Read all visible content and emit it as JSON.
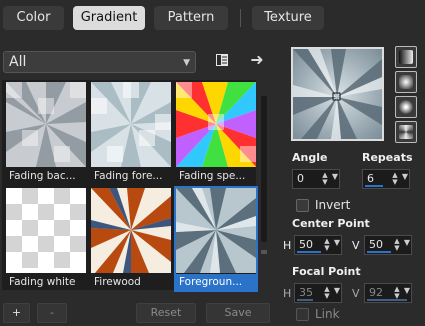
{
  "tabs": [
    "Color",
    "Gradient",
    "Pattern",
    "Texture"
  ],
  "active_tab": "Gradient",
  "category_select": {
    "value": "All"
  },
  "thumbnails": [
    {
      "label": "Fading bac...",
      "selected": false
    },
    {
      "label": "Fading fore...",
      "selected": false
    },
    {
      "label": "Fading spe...",
      "selected": false
    },
    {
      "label": "Fading white",
      "selected": false
    },
    {
      "label": "Firewood",
      "selected": false
    },
    {
      "label": "Foregroun...",
      "selected": true
    }
  ],
  "bottom_buttons": {
    "add": "+",
    "remove": "-",
    "reset": "Reset",
    "save": "Save"
  },
  "angle": {
    "label": "Angle",
    "value": "0"
  },
  "repeats": {
    "label": "Repeats",
    "value": "6"
  },
  "invert": {
    "label": "Invert",
    "checked": false
  },
  "center_point": {
    "label": "Center Point",
    "h_label": "H",
    "h_value": "50",
    "v_label": "V",
    "v_value": "50"
  },
  "focal_point": {
    "label": "Focal Point",
    "h_label": "H",
    "h_value": "35",
    "v_label": "V",
    "v_value": "92"
  },
  "link": {
    "label": "Link",
    "checked": false,
    "enabled": false
  },
  "colors": {
    "accent": "#2a73c9",
    "background": "#2b2b2b"
  }
}
